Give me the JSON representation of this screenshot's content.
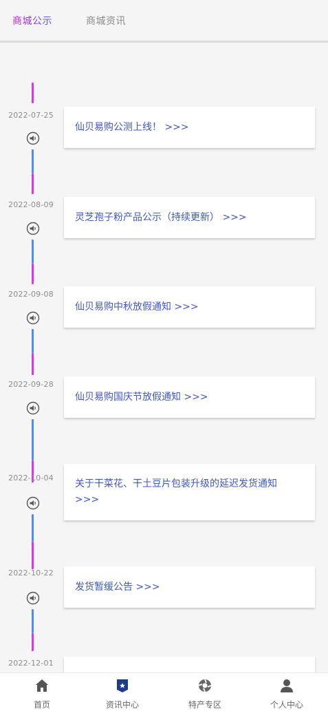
{
  "tabs": [
    {
      "label": "商城公示",
      "active": true
    },
    {
      "label": "商城资讯",
      "active": false
    }
  ],
  "colors": {
    "accent_start": "#d21bd9",
    "accent_end": "#4b63e6",
    "card_text": "#3f57c9",
    "nav_active": "#1e3a8c"
  },
  "notices": [
    {
      "date": "2022-07-25",
      "title": "仙贝易购公测上线！ >>>"
    },
    {
      "date": "2022-08-09",
      "title": "灵芝孢子粉产品公示（持续更新） >>>"
    },
    {
      "date": "2022-09-08",
      "title": "仙贝易购中秋放假通知 >>>"
    },
    {
      "date": "2022-09-28",
      "title": "仙贝易购国庆节放假通知 >>>"
    },
    {
      "date": "2022-10-04",
      "title": "关于干菜花、干土豆片包装升级的延迟发货通知 >>>"
    },
    {
      "date": "2022-10-22",
      "title": "发货暂缓公告 >>>"
    },
    {
      "date": "2022-12-01",
      "title": ""
    }
  ],
  "bottom_nav": [
    {
      "label": "首页",
      "icon": "home-icon",
      "active": false
    },
    {
      "label": "资讯中心",
      "icon": "news-icon",
      "active": true
    },
    {
      "label": "特产专区",
      "icon": "specialty-icon",
      "active": false
    },
    {
      "label": "个人中心",
      "icon": "user-icon",
      "active": false
    }
  ]
}
